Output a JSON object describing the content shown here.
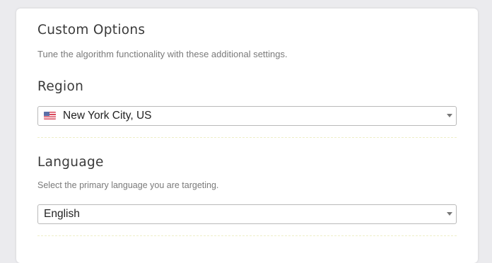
{
  "custom_options": {
    "title": "Custom Options",
    "subtitle": "Tune the algorithm functionality with these additional settings."
  },
  "region": {
    "label": "Region",
    "selected": "New York City, US",
    "flag_icon": "us-flag-icon",
    "dropdown_icon": "caret-down-icon"
  },
  "language": {
    "label": "Language",
    "description": "Select the primary language you are targeting.",
    "selected": "English",
    "dropdown_icon": "caret-down-icon"
  },
  "colors": {
    "background": "#ebebee",
    "card": "#ffffff",
    "heading": "#3a3a3a",
    "muted_text": "#7a7a7a",
    "select_border": "#b9b9b9",
    "divider": "#eeeec8"
  }
}
